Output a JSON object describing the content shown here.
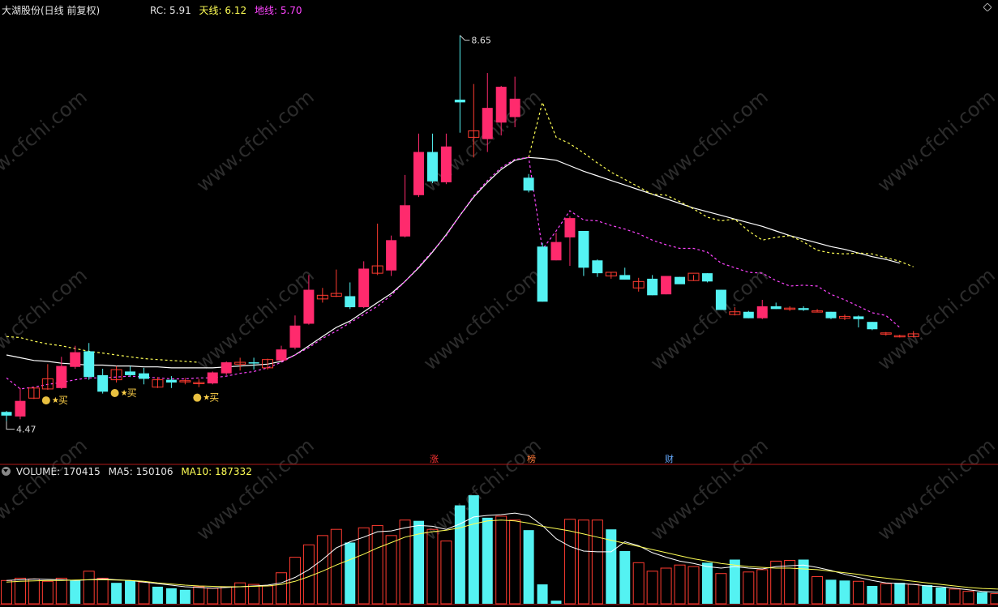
{
  "header": {
    "stock_name": "大湖股份(日线 前复权)",
    "rc_label": "RC:",
    "rc_value": "5.91",
    "tianxian_label": "天线:",
    "tianxian_value": "6.12",
    "dixian_label": "地线:",
    "dixian_value": "5.70"
  },
  "volume_header": {
    "volume_label": "VOLUME:",
    "volume_value": "170415",
    "ma5_label": "MA5:",
    "ma5_value": "150106",
    "ma10_label": "MA10:",
    "ma10_value": "187332"
  },
  "markers": {
    "zhang": "涨",
    "bang": "榜",
    "cai": "财"
  },
  "watermark": "www.cfchi.com",
  "colors": {
    "up": "#ff2a6d",
    "up_outline": "#ff3b30",
    "down": "#54f2f2",
    "rc": "#ffffff",
    "tianxian": "#ffff55",
    "dixian": "#ff44ff",
    "ma5": "#ffffff",
    "ma10": "#ffff55"
  },
  "chart_data": [
    {
      "type": "candlestick",
      "title": "大湖股份(日线 前复权)",
      "annotations": [
        "8.65",
        "4.47"
      ],
      "buy_signal_label": "买",
      "ylim": [
        4.3,
        8.8
      ],
      "candles": [
        {
          "o": 4.58,
          "h": 4.59,
          "l": 4.48,
          "c": 4.54
        },
        {
          "o": 4.53,
          "h": 4.84,
          "l": 4.5,
          "c": 4.7
        },
        {
          "o": 4.73,
          "h": 4.85,
          "l": 4.72,
          "c": 4.84
        },
        {
          "o": 4.83,
          "h": 5.1,
          "l": 4.82,
          "c": 4.94
        },
        {
          "o": 4.84,
          "h": 5.18,
          "l": 4.83,
          "c": 5.08
        },
        {
          "o": 5.07,
          "h": 5.3,
          "l": 5.05,
          "c": 5.23
        },
        {
          "o": 5.24,
          "h": 5.33,
          "l": 4.93,
          "c": 4.96
        },
        {
          "o": 4.98,
          "h": 5.05,
          "l": 4.78,
          "c": 4.8
        },
        {
          "o": 4.93,
          "h": 5.08,
          "l": 4.9,
          "c": 5.04
        },
        {
          "o": 5.02,
          "h": 5.08,
          "l": 4.96,
          "c": 4.98
        },
        {
          "o": 5.0,
          "h": 5.06,
          "l": 4.88,
          "c": 4.94
        },
        {
          "o": 4.85,
          "h": 4.96,
          "l": 4.84,
          "c": 4.93
        },
        {
          "o": 4.93,
          "h": 4.97,
          "l": 4.84,
          "c": 4.9
        },
        {
          "o": 4.91,
          "h": 4.95,
          "l": 4.88,
          "c": 4.92
        },
        {
          "o": 4.9,
          "h": 4.94,
          "l": 4.85,
          "c": 4.9
        },
        {
          "o": 4.89,
          "h": 5.02,
          "l": 4.88,
          "c": 5.01
        },
        {
          "o": 5.0,
          "h": 5.13,
          "l": 4.98,
          "c": 5.12
        },
        {
          "o": 5.1,
          "h": 5.17,
          "l": 5.03,
          "c": 5.12
        },
        {
          "o": 5.12,
          "h": 5.17,
          "l": 5.04,
          "c": 5.11
        },
        {
          "o": 5.06,
          "h": 5.16,
          "l": 5.04,
          "c": 5.15
        },
        {
          "o": 5.14,
          "h": 5.3,
          "l": 5.13,
          "c": 5.26
        },
        {
          "o": 5.28,
          "h": 5.63,
          "l": 5.26,
          "c": 5.52
        },
        {
          "o": 5.54,
          "h": 6.07,
          "l": 5.53,
          "c": 5.91
        },
        {
          "o": 5.81,
          "h": 5.93,
          "l": 5.77,
          "c": 5.85
        },
        {
          "o": 5.84,
          "h": 6.13,
          "l": 5.83,
          "c": 5.87
        },
        {
          "o": 5.84,
          "h": 5.99,
          "l": 5.7,
          "c": 5.72
        },
        {
          "o": 5.72,
          "h": 6.22,
          "l": 5.71,
          "c": 6.14
        },
        {
          "o": 6.09,
          "h": 6.63,
          "l": 6.07,
          "c": 6.17
        },
        {
          "o": 6.12,
          "h": 6.5,
          "l": 6.06,
          "c": 6.45
        },
        {
          "o": 6.49,
          "h": 7.16,
          "l": 6.48,
          "c": 6.83
        },
        {
          "o": 6.94,
          "h": 7.61,
          "l": 6.92,
          "c": 7.41
        },
        {
          "o": 7.41,
          "h": 7.61,
          "l": 7.07,
          "c": 7.09
        },
        {
          "o": 7.08,
          "h": 7.61,
          "l": 7.06,
          "c": 7.47
        },
        {
          "o": 7.98,
          "h": 8.68,
          "l": 7.62,
          "c": 7.95
        },
        {
          "o": 7.57,
          "h": 8.15,
          "l": 7.35,
          "c": 7.64
        },
        {
          "o": 7.55,
          "h": 8.27,
          "l": 7.41,
          "c": 7.89
        },
        {
          "o": 7.73,
          "h": 8.13,
          "l": 7.59,
          "c": 8.12
        },
        {
          "o": 7.79,
          "h": 8.23,
          "l": 7.68,
          "c": 7.99
        },
        {
          "o": 7.13,
          "h": 7.17,
          "l": 6.97,
          "c": 6.99
        },
        {
          "o": 6.38,
          "h": 6.42,
          "l": 5.78,
          "c": 5.78
        },
        {
          "o": 6.23,
          "h": 6.53,
          "l": 6.23,
          "c": 6.43
        },
        {
          "o": 6.48,
          "h": 6.71,
          "l": 6.17,
          "c": 6.69
        },
        {
          "o": 6.55,
          "h": 6.55,
          "l": 6.06,
          "c": 6.15
        },
        {
          "o": 6.23,
          "h": 6.24,
          "l": 6.05,
          "c": 6.09
        },
        {
          "o": 6.06,
          "h": 6.1,
          "l": 6.03,
          "c": 6.1
        },
        {
          "o": 6.07,
          "h": 6.15,
          "l": 6.02,
          "c": 6.02
        },
        {
          "o": 5.93,
          "h": 6.04,
          "l": 5.89,
          "c": 6.0
        },
        {
          "o": 6.03,
          "h": 6.07,
          "l": 5.85,
          "c": 5.85
        },
        {
          "o": 5.86,
          "h": 6.06,
          "l": 5.86,
          "c": 6.06
        },
        {
          "o": 6.05,
          "h": 6.05,
          "l": 6.02,
          "c": 5.97
        },
        {
          "o": 6.01,
          "h": 6.07,
          "l": 6.01,
          "c": 6.09
        },
        {
          "o": 6.09,
          "h": 6.09,
          "l": 5.99,
          "c": 6.0
        },
        {
          "o": 5.91,
          "h": 5.91,
          "l": 5.69,
          "c": 5.69
        },
        {
          "o": 5.64,
          "h": 5.72,
          "l": 5.63,
          "c": 5.67
        },
        {
          "o": 5.67,
          "h": 5.68,
          "l": 5.6,
          "c": 5.6
        },
        {
          "o": 5.6,
          "h": 5.8,
          "l": 5.59,
          "c": 5.73
        },
        {
          "o": 5.73,
          "h": 5.77,
          "l": 5.7,
          "c": 5.7
        },
        {
          "o": 5.7,
          "h": 5.73,
          "l": 5.68,
          "c": 5.71
        },
        {
          "o": 5.71,
          "h": 5.73,
          "l": 5.68,
          "c": 5.69
        },
        {
          "o": 5.68,
          "h": 5.7,
          "l": 5.67,
          "c": 5.68
        },
        {
          "o": 5.67,
          "h": 5.67,
          "l": 5.59,
          "c": 5.6
        },
        {
          "o": 5.6,
          "h": 5.64,
          "l": 5.58,
          "c": 5.62
        },
        {
          "o": 5.62,
          "h": 5.63,
          "l": 5.5,
          "c": 5.59
        },
        {
          "o": 5.56,
          "h": 5.56,
          "l": 5.47,
          "c": 5.48
        },
        {
          "o": 5.44,
          "h": 5.45,
          "l": 5.41,
          "c": 5.44
        },
        {
          "o": 5.41,
          "h": 5.42,
          "l": 5.39,
          "c": 5.41
        },
        {
          "o": 5.4,
          "h": 5.46,
          "l": 5.39,
          "c": 5.43
        }
      ],
      "buy_signal_indices": [
        3,
        8,
        14
      ],
      "rc_line": [
        5.2,
        5.17,
        5.14,
        5.13,
        5.11,
        5.1,
        5.09,
        5.09,
        5.08,
        5.08,
        5.07,
        5.07,
        5.06,
        5.06,
        5.06,
        5.06,
        5.07,
        5.08,
        5.09,
        5.1,
        5.13,
        5.2,
        5.3,
        5.4,
        5.5,
        5.57,
        5.67,
        5.77,
        5.87,
        6.0,
        6.15,
        6.32,
        6.51,
        6.72,
        6.92,
        7.08,
        7.22,
        7.32,
        7.35,
        7.34,
        7.32,
        7.26,
        7.2,
        7.15,
        7.1,
        7.05,
        7.0,
        6.95,
        6.9,
        6.85,
        6.8,
        6.76,
        6.72,
        6.68,
        6.64,
        6.6,
        6.55,
        6.5,
        6.46,
        6.42,
        6.38,
        6.35,
        6.31,
        6.27,
        6.24,
        6.2
      ],
      "tianxian_line": [
        5.4,
        5.39,
        5.35,
        5.32,
        5.3,
        5.27,
        5.24,
        5.22,
        5.2,
        5.18,
        5.16,
        5.15,
        5.14,
        5.13,
        5.12,
        null,
        null,
        null,
        null,
        null,
        null,
        null,
        null,
        null,
        null,
        null,
        null,
        null,
        null,
        null,
        null,
        null,
        null,
        null,
        null,
        null,
        null,
        null,
        7.35,
        7.95,
        7.57,
        7.5,
        7.4,
        7.29,
        7.19,
        7.11,
        7.03,
        6.95,
        6.94,
        6.87,
        6.79,
        6.7,
        6.66,
        6.68,
        6.55,
        6.45,
        6.48,
        6.5,
        6.43,
        6.34,
        6.31,
        6.3,
        6.31,
        6.3,
        6.26,
        6.22,
        6.16
      ],
      "dixian_line": [
        4.95,
        4.83,
        4.85,
        4.88,
        4.9,
        4.93,
        4.95,
        4.95,
        4.96,
        4.97,
        4.96,
        4.95,
        4.94,
        4.94,
        4.95,
        4.95,
        4.97,
        5.0,
        5.02,
        5.06,
        5.12,
        5.2,
        5.28,
        5.38,
        5.46,
        5.55,
        5.64,
        5.73,
        5.85,
        6.0,
        6.16,
        6.33,
        6.5,
        6.72,
        6.93,
        7.1,
        7.24,
        7.33,
        7.35,
        6.35,
        6.55,
        6.77,
        6.67,
        6.66,
        6.61,
        6.57,
        6.52,
        6.45,
        6.4,
        6.36,
        6.36,
        6.32,
        6.2,
        6.15,
        6.1,
        6.09,
        6.01,
        5.95,
        5.96,
        5.95,
        5.86,
        5.8,
        5.73,
        5.66,
        5.63,
        5.5
      ]
    },
    {
      "type": "bar",
      "title": "VOLUME",
      "ylim": [
        0,
        160000
      ],
      "volumes": [
        30000,
        33000,
        32000,
        29000,
        33000,
        30000,
        42000,
        33000,
        27000,
        30000,
        28000,
        22000,
        20000,
        18000,
        22000,
        20000,
        22000,
        27000,
        25000,
        23000,
        40000,
        60000,
        76000,
        88000,
        96000,
        79000,
        98000,
        101000,
        88000,
        108000,
        107000,
        96000,
        81000,
        127000,
        140000,
        111000,
        113000,
        108000,
        95000,
        25000,
        4000,
        109000,
        108000,
        108000,
        96000,
        68000,
        53000,
        42000,
        46000,
        50000,
        48000,
        53000,
        39000,
        57000,
        41000,
        44000,
        55000,
        56000,
        57000,
        35000,
        31000,
        30000,
        29000,
        23000,
        26000,
        27000,
        25000,
        24000,
        21000,
        19000,
        16000,
        15000,
        13000,
        18000
      ],
      "up": [
        true,
        true,
        true,
        true,
        true,
        false,
        true,
        true,
        false,
        false,
        true,
        false,
        false,
        false,
        true,
        true,
        true,
        true,
        true,
        true,
        true,
        true,
        true,
        true,
        true,
        false,
        true,
        true,
        true,
        true,
        false,
        true,
        true,
        false,
        false,
        false,
        true,
        true,
        false,
        false,
        false,
        true,
        true,
        true,
        false,
        false,
        true,
        true,
        true,
        true,
        true,
        false,
        true,
        false,
        true,
        true,
        true,
        true,
        false,
        true,
        false,
        false,
        true,
        false,
        true,
        false,
        true,
        false,
        false,
        true,
        true,
        false,
        true,
        true
      ],
      "ma5": [
        30000,
        31000,
        32000,
        31500,
        31000,
        30000,
        31000,
        32000,
        31000,
        30000,
        28000,
        26000,
        24000,
        22000,
        21000,
        20000,
        21000,
        22000,
        23000,
        24000,
        27000,
        34000,
        44000,
        57000,
        72000,
        80000,
        86000,
        93000,
        94000,
        98000,
        101000,
        100000,
        96000,
        103000,
        112000,
        114000,
        115000,
        117000,
        114000,
        101000,
        84000,
        74000,
        68000,
        67000,
        67000,
        80000,
        75000,
        66000,
        60000,
        55000,
        52000,
        48000,
        46000,
        48000,
        46000,
        45000,
        48000,
        49000,
        50000,
        47000,
        43000,
        38000,
        34000,
        30000,
        27000,
        26000,
        25000,
        23000,
        22000,
        20000,
        18000,
        16000,
        15000,
        15010
      ],
      "ma10": [
        28000,
        29000,
        29500,
        30000,
        30000,
        30500,
        31000,
        31000,
        30500,
        30000,
        29000,
        27000,
        25500,
        24000,
        23000,
        22500,
        22000,
        22000,
        22500,
        23000,
        25000,
        29000,
        35000,
        42000,
        50000,
        57000,
        64000,
        72000,
        79000,
        86000,
        90000,
        93000,
        95000,
        98000,
        103000,
        107000,
        108000,
        107000,
        104000,
        100000,
        97000,
        94000,
        90000,
        86000,
        82000,
        78000,
        74000,
        70000,
        66000,
        62000,
        58000,
        55000,
        52000,
        50000,
        48000,
        47000,
        46000,
        46000,
        45000,
        44000,
        42000,
        40000,
        38000,
        35000,
        33000,
        31000,
        29000,
        27000,
        25000,
        23000,
        21000,
        19800,
        19000,
        18700
      ]
    }
  ]
}
